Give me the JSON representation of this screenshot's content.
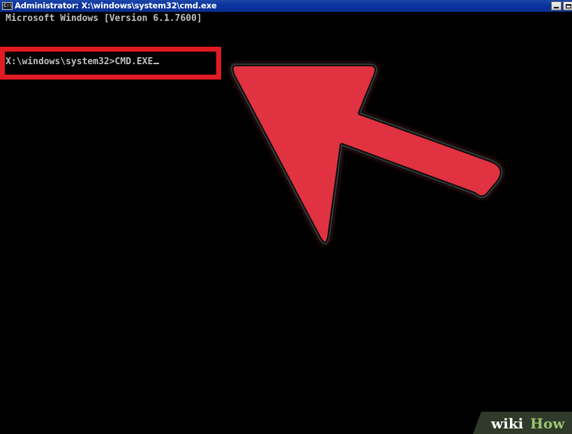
{
  "window": {
    "title": "Administrator: X:\\windows\\system32\\cmd.exe",
    "app_icon_glyph": "C:\\",
    "title_bar_color": "#0b34a0"
  },
  "console": {
    "version_line": "Microsoft Windows [Version 6.1.7600]",
    "prompt": "X:\\windows\\system32>",
    "command": "CMD.EXE",
    "text_color": "#c0c0c0",
    "background_color": "#000000"
  },
  "annotation": {
    "highlight_color": "#e11b22",
    "arrow_color": "#e0313f",
    "arrow_icon": "arrow-pointer-icon"
  },
  "watermark": {
    "wiki": "wiki",
    "how": "How"
  }
}
